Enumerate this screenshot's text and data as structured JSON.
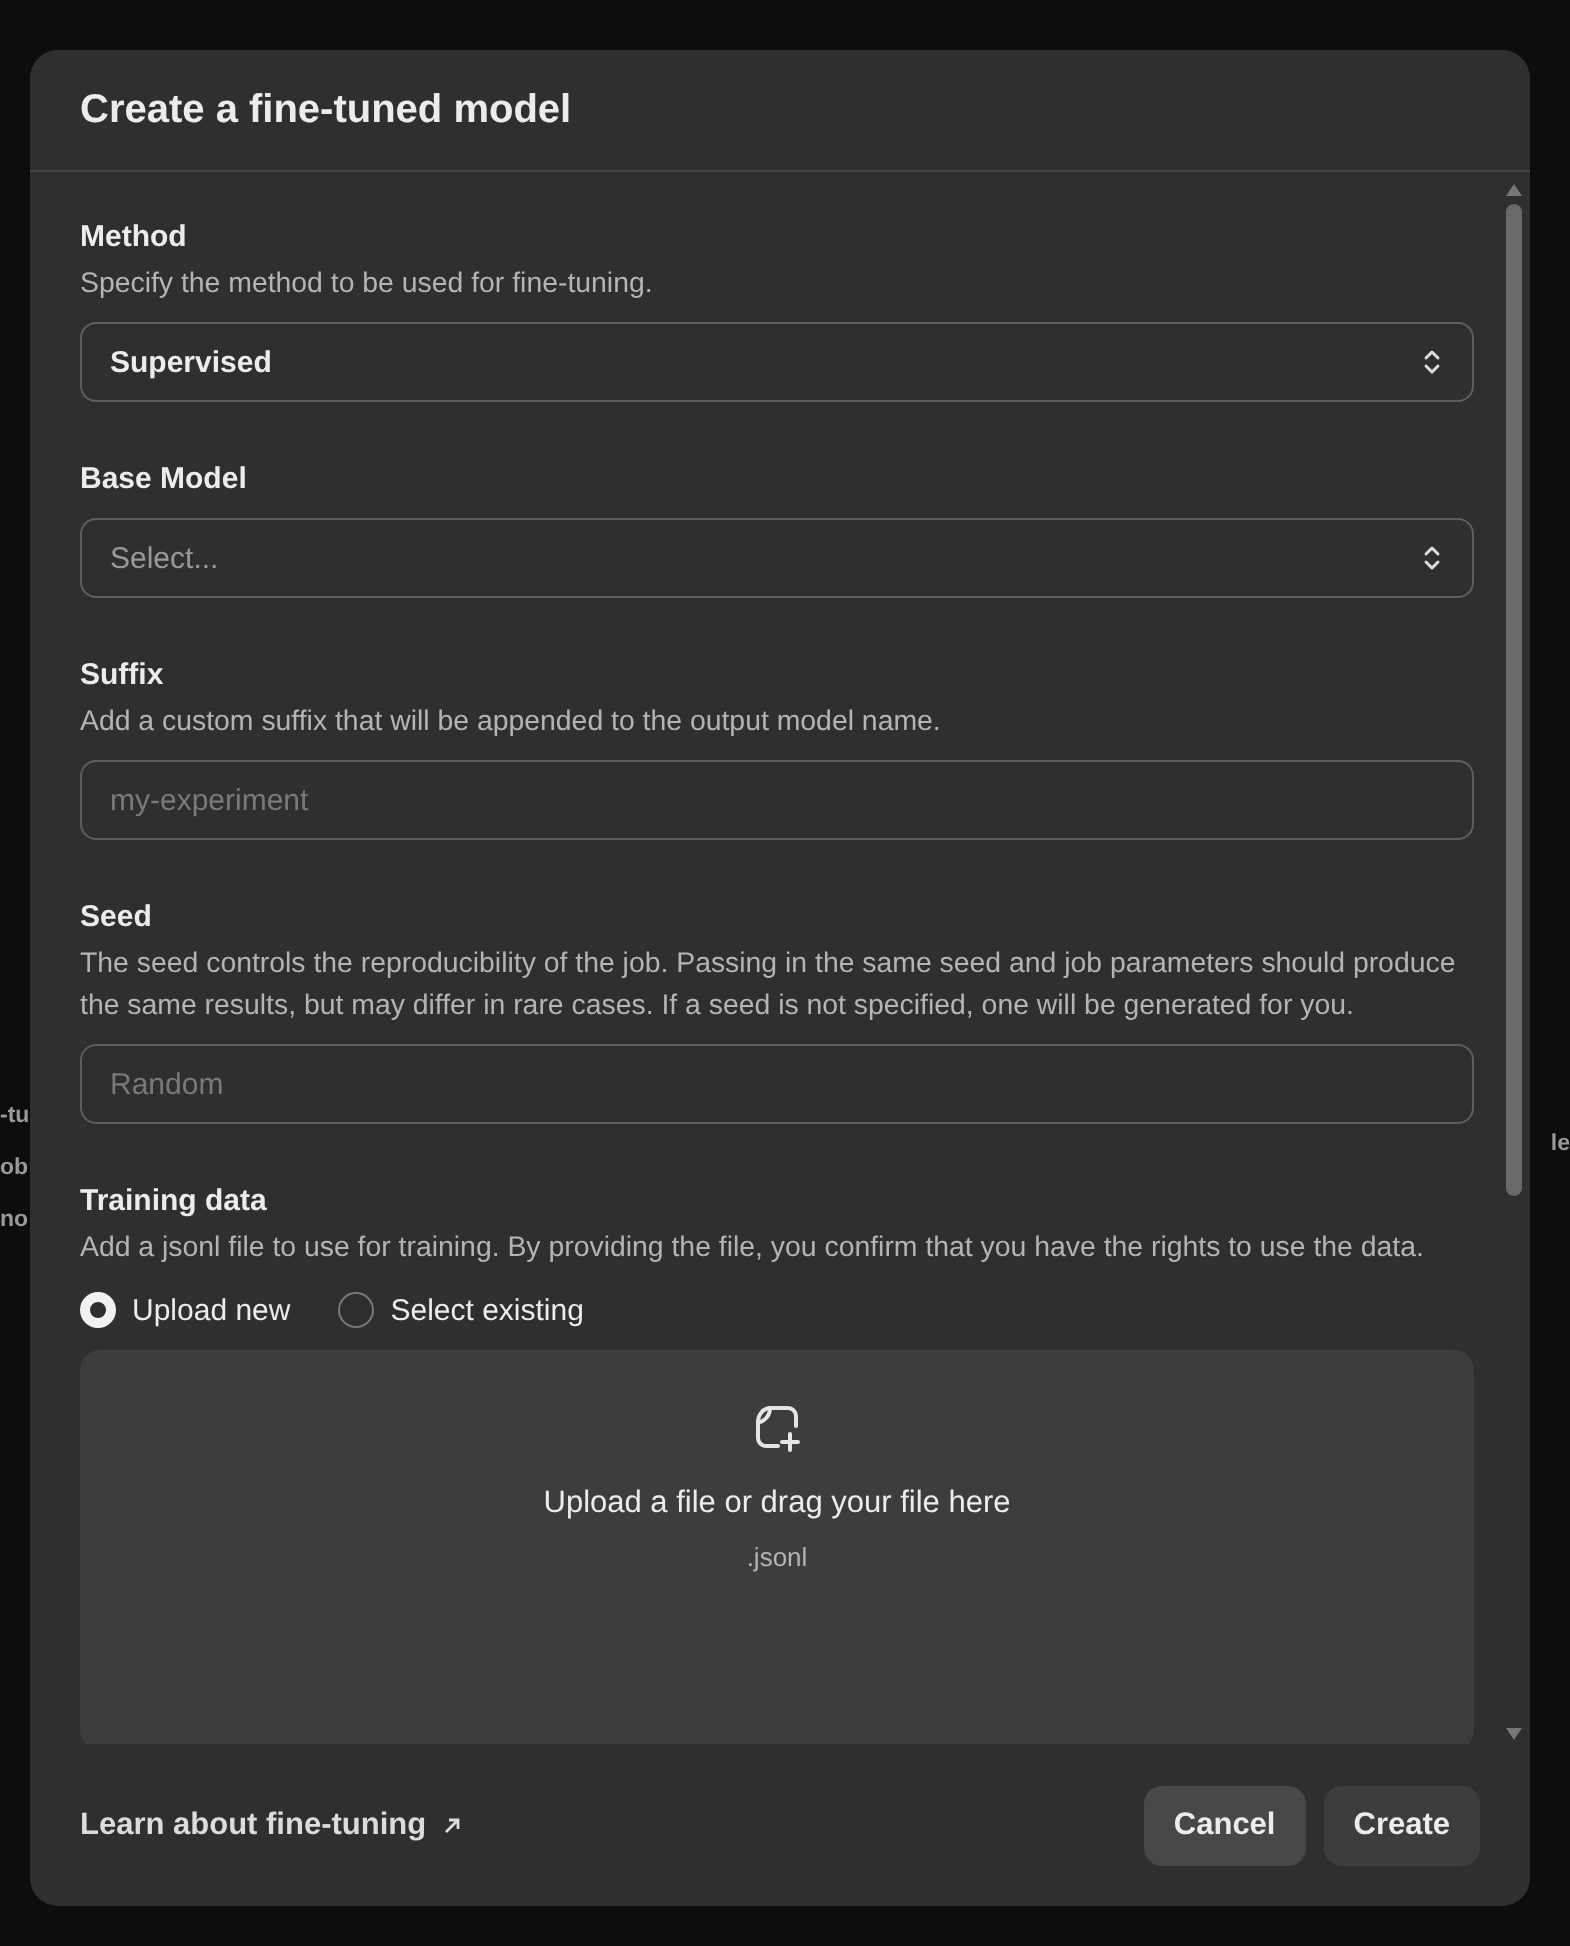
{
  "background": {
    "left_fragments": [
      "-tu",
      "ob",
      "no"
    ],
    "right_fragments": [
      "le"
    ]
  },
  "dialog": {
    "title": "Create a fine-tuned model"
  },
  "sections": [
    {
      "kind": "select",
      "label": "Method",
      "description": "Specify the method to be used for fine-tuning.",
      "value": "Supervised"
    },
    {
      "kind": "select",
      "label": "Base Model",
      "placeholder": "Select..."
    },
    {
      "kind": "text",
      "label": "Suffix",
      "description": "Add a custom suffix that will be appended to the output model name.",
      "placeholder": "my-experiment"
    },
    {
      "kind": "text",
      "label": "Seed",
      "description": "The seed controls the reproducibility of the job. Passing in the same seed and job parameters should produce the same results, but may differ in rare cases. If a seed is not specified, one will be generated for you.",
      "placeholder": "Random"
    },
    {
      "kind": "upload",
      "label": "Training data",
      "description": "Add a jsonl file to use for training. By providing the file, you confirm that you have the rights to use the data.",
      "options": [
        {
          "label": "Upload new",
          "selected": true
        },
        {
          "label": "Select existing",
          "selected": false
        }
      ],
      "dropzone": {
        "text": "Upload a file or drag your file here",
        "hint": ".jsonl"
      }
    }
  ],
  "footer": {
    "link": "Learn about fine-tuning",
    "buttons": [
      {
        "label": "Cancel",
        "kind": "secondary"
      },
      {
        "label": "Create",
        "kind": "primary"
      }
    ]
  }
}
